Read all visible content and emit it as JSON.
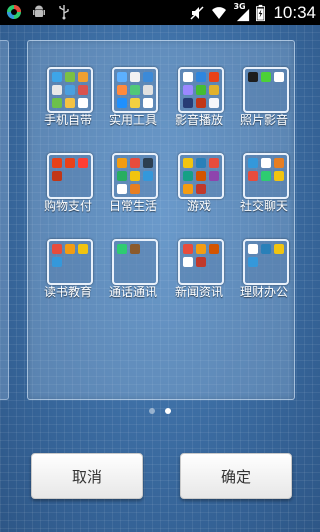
{
  "status_bar": {
    "time": "10:34",
    "network_label": "3G",
    "left_icons": [
      "app-icon",
      "android-debug-icon",
      "usb-icon"
    ],
    "right_icons": [
      "mute-icon",
      "wifi-icon",
      "signal-icon",
      "battery-icon"
    ]
  },
  "folders": [
    {
      "label": "手机自带",
      "apps": [
        "#3da5e8",
        "#7bc043",
        "#f0a030",
        "#e8e8e8",
        "#4aa0e0",
        "#d9534f",
        "#6cc04a",
        "#f5c242",
        "#ffffff"
      ]
    },
    {
      "label": "实用工具",
      "apps": [
        "#5cb0ff",
        "#f2f2f2",
        "#3c8ad8",
        "#ff8a3d",
        "#50c878",
        "#e0e0e0",
        "#1e90ff",
        "#f4d03f",
        "#ffffff"
      ]
    },
    {
      "label": "影音播放",
      "apps": [
        "#ffffff",
        "#2e86de",
        "#e84118",
        "#9c88ff",
        "#44bd32",
        "#e1b12c",
        "#273c75",
        "#c23616",
        "#f5f6fa"
      ]
    },
    {
      "label": "照片影音",
      "apps": [
        "#1d1d1d",
        "#4cd137",
        "#ffffff"
      ]
    },
    {
      "label": "购物支付",
      "apps": [
        "#e84118",
        "#e84118",
        "#ff3f34",
        "#c23616"
      ]
    },
    {
      "label": "日常生活",
      "apps": [
        "#f39c12",
        "#e74c3c",
        "#2c3e50",
        "#27ae60",
        "#f1c40f",
        "#3498db",
        "#ffffff",
        "#e67e22"
      ]
    },
    {
      "label": "游戏",
      "apps": [
        "#f1c40f",
        "#2980b9",
        "#e74c3c",
        "#16a085",
        "#d35400",
        "#8e44ad",
        "#f39c12",
        "#c0392b"
      ]
    },
    {
      "label": "社交聊天",
      "apps": [
        "#3498db",
        "#ffffff",
        "#e67e22",
        "#e74c3c",
        "#2ecc71",
        "#f1c40f"
      ]
    },
    {
      "label": "读书教育",
      "apps": [
        "#e74c3c",
        "#f39c12",
        "#f1c40f",
        "#3498db"
      ]
    },
    {
      "label": "通话通讯",
      "apps": [
        "#2ecc71",
        "#8b5a2b"
      ]
    },
    {
      "label": "新闻资讯",
      "apps": [
        "#e74c3c",
        "#f39c12",
        "#d35400",
        "#ffffff",
        "#c0392b"
      ]
    },
    {
      "label": "理财办公",
      "apps": [
        "#ffffff",
        "#2980b9",
        "#f1c40f",
        "#3498db"
      ]
    }
  ],
  "pager": {
    "current": 2,
    "total": 2
  },
  "buttons": {
    "cancel": "取消",
    "confirm": "确定"
  },
  "colors": {
    "background": "#3a6aa0",
    "status_bar": "#000000",
    "folder_border": "#e9f1fb",
    "button_bg": "#ffffff"
  }
}
